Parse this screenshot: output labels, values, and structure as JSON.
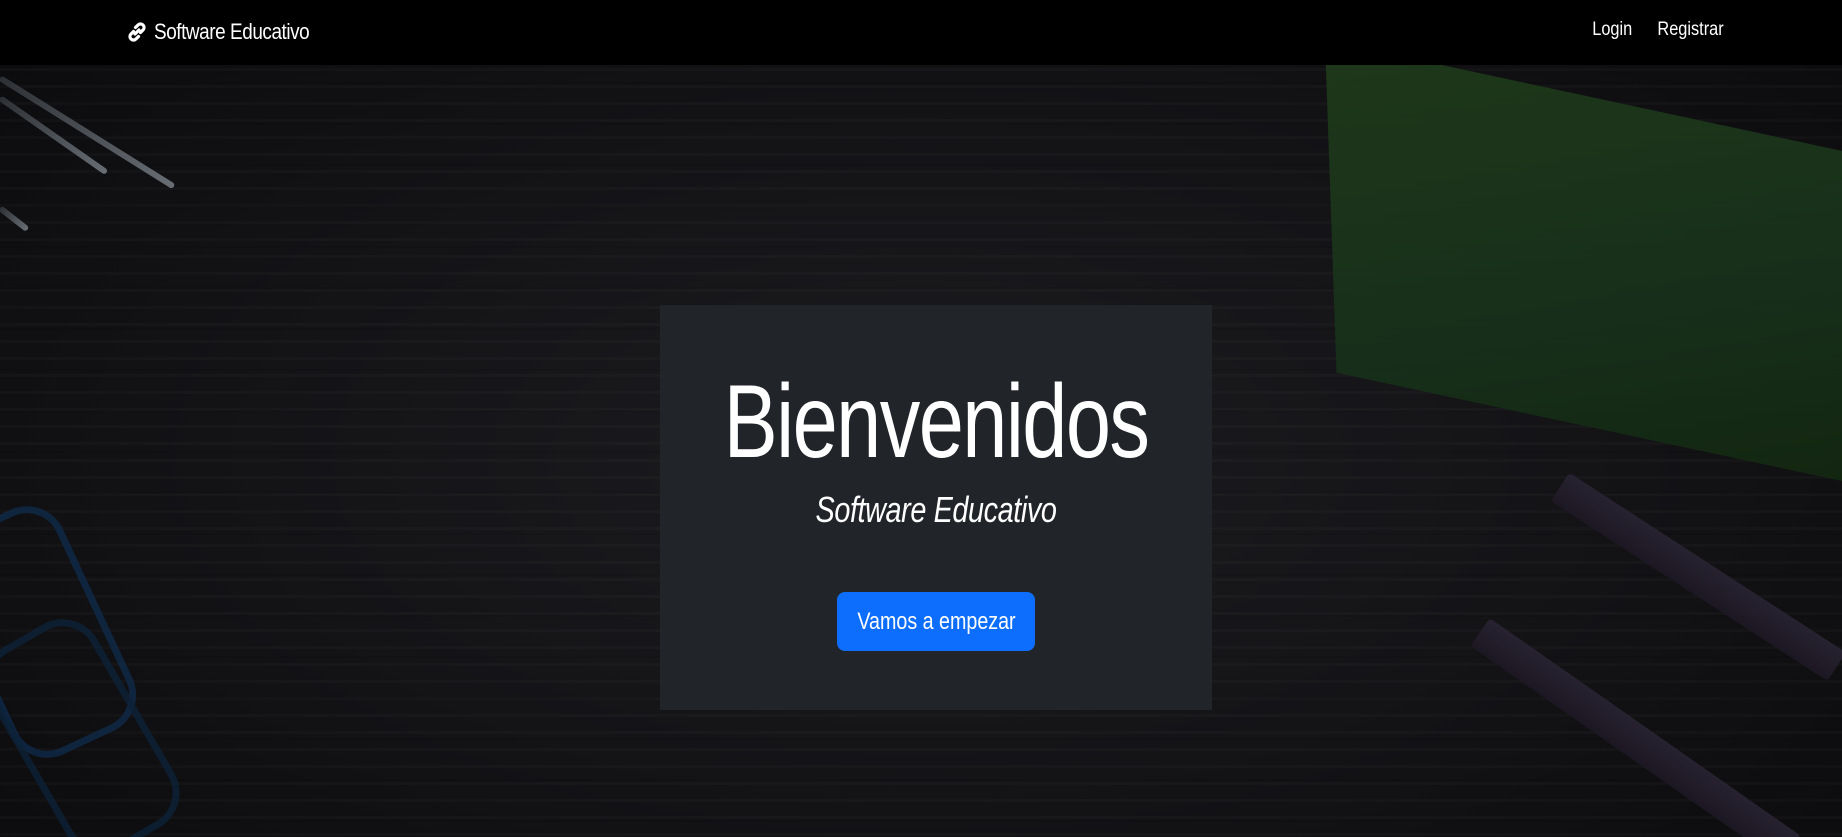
{
  "navbar": {
    "brand": {
      "icon": "link-icon",
      "text": "Software Educativo"
    },
    "links": [
      {
        "label": "Login"
      },
      {
        "label": "Registrar"
      }
    ]
  },
  "hero": {
    "title": "Bienvenidos",
    "subtitle": "Software Educativo",
    "cta_label": "Vamos a empezar"
  },
  "colors": {
    "navbar_bg": "#000000",
    "card_bg": "#212429",
    "button_bg": "#0d6efd",
    "text": "#ffffff"
  }
}
